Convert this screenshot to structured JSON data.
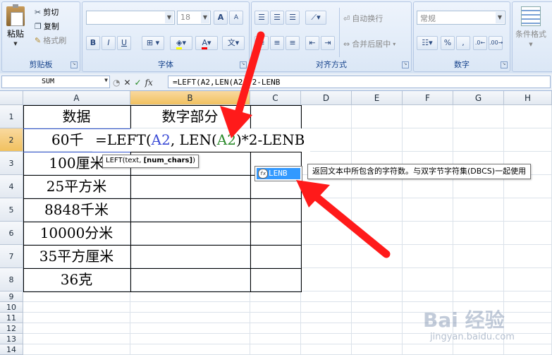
{
  "ribbon": {
    "clipboard": {
      "paste": "粘贴",
      "cut": "剪切",
      "copy": "复制",
      "format_painter": "格式刷",
      "label": "剪贴板"
    },
    "font": {
      "font_size": "18",
      "bold": "B",
      "italic": "I",
      "underline": "U",
      "label": "字体",
      "grow": "A",
      "shrink": "A"
    },
    "alignment": {
      "wrap_text": "自动换行",
      "merge_center": "合并后居中",
      "label": "对齐方式"
    },
    "number": {
      "format": "常规",
      "percent": "%",
      "comma": ",",
      "label": "数字"
    },
    "styles": {
      "conditional": "条件格式"
    }
  },
  "formula_bar": {
    "name_box": "SUM",
    "cancel": "✕",
    "enter": "✓",
    "fx": "fx",
    "formula": "=LEFT(A2,LEN(A2)*2-LENB"
  },
  "columns": [
    "A",
    "B",
    "C",
    "D",
    "E",
    "F",
    "G",
    "H"
  ],
  "rows": [
    "1",
    "2",
    "3",
    "4",
    "5",
    "6",
    "7",
    "8",
    "9",
    "10",
    "11",
    "12",
    "13",
    "14"
  ],
  "cells": {
    "A1": "数据",
    "B1": "数字部分",
    "A2": "60千",
    "A3": "100厘米",
    "A4": "25平方米",
    "A5": "8848千米",
    "A6": "10000分米",
    "A7": "35平方厘米",
    "A8": "36克"
  },
  "editing": {
    "p1": "=LEFT",
    "p2": "(",
    "p3": "A2",
    "p4": ", LEN",
    "p5": "(",
    "p6": "A2",
    "p7": ")",
    "p8": "*2-LENB",
    "color_a2_first": "#3b4bd6",
    "color_a2_second": "#2e8b2e"
  },
  "tooltip": {
    "text": "LEFT(text, ",
    "bold": "[num_chars]",
    "close": ")"
  },
  "autocomplete": {
    "item": "LENB",
    "icon": "fx",
    "description": "返回文本中所包含的字符数。与双字节字符集(DBCS)一起使用"
  },
  "watermark": {
    "logo": "Bai 经验",
    "url": "jingyan.baidu.com"
  },
  "colors": {
    "accent": "#15428b",
    "arrow": "#ff1a1a",
    "selection": "#3399ff"
  }
}
